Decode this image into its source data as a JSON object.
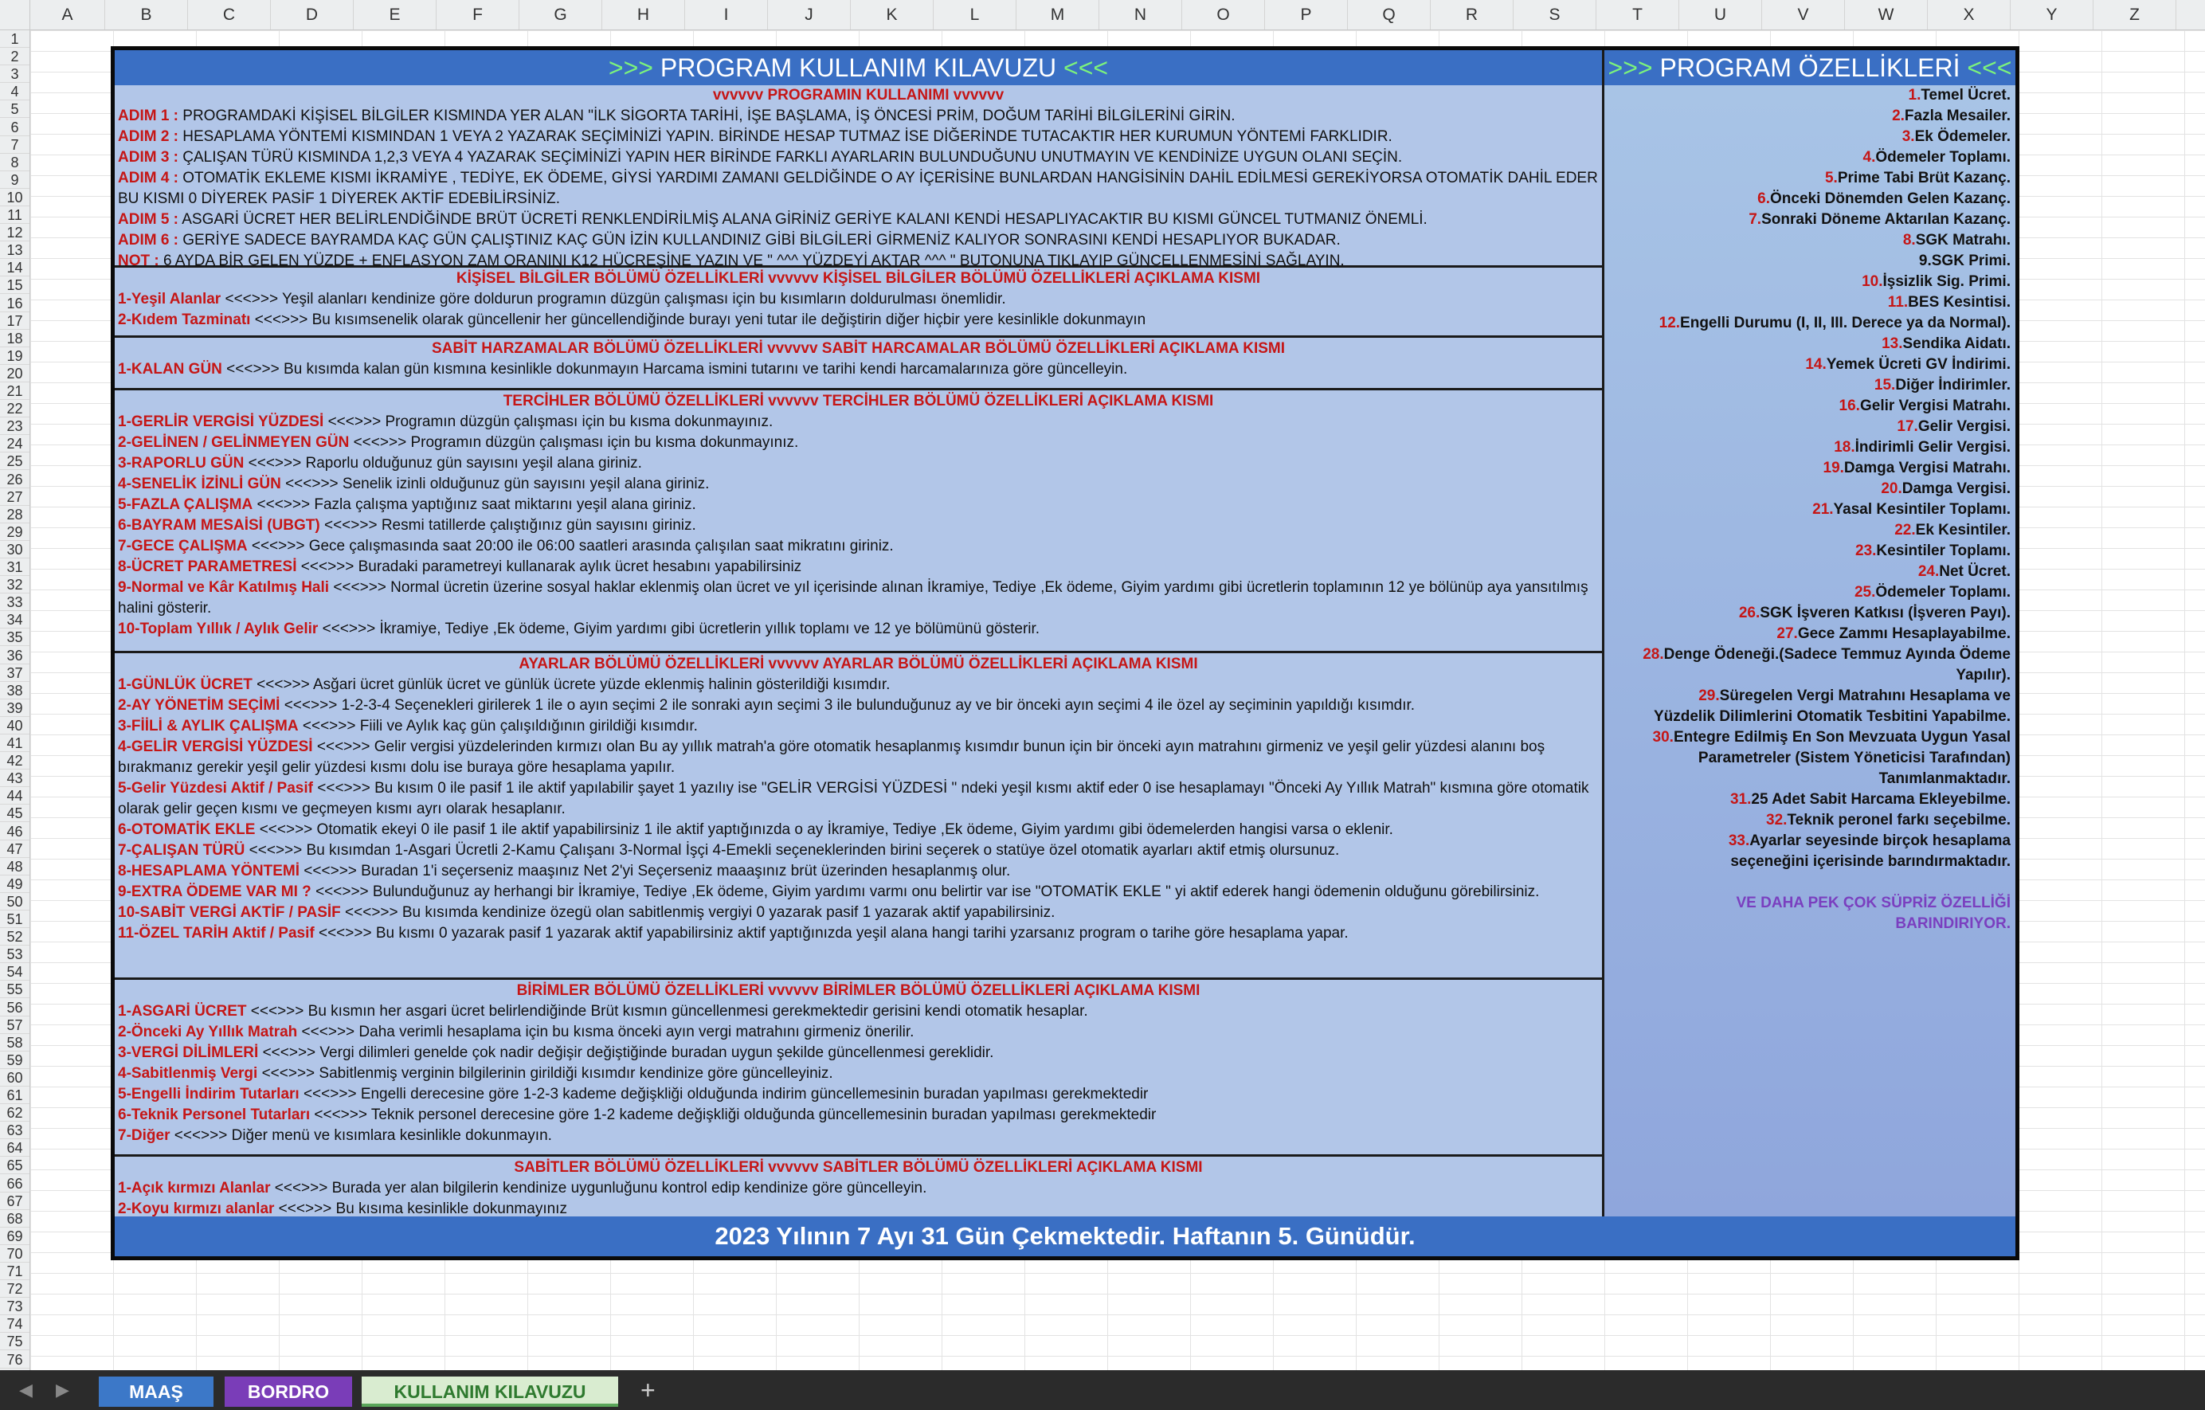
{
  "columns": [
    "A",
    "B",
    "C",
    "D",
    "E",
    "F",
    "G",
    "H",
    "I",
    "J",
    "K",
    "L",
    "M",
    "N",
    "O",
    "P",
    "Q",
    "R",
    "S",
    "T",
    "U",
    "V",
    "W",
    "X",
    "Y",
    "Z"
  ],
  "rows": [
    "1",
    "2",
    "3",
    "4",
    "5",
    "6",
    "7",
    "8",
    "9",
    "10",
    "11",
    "12",
    "13",
    "14",
    "15",
    "16",
    "17",
    "18",
    "19",
    "20",
    "21",
    "22",
    "23",
    "24",
    "25",
    "26",
    "27",
    "28",
    "29",
    "30",
    "31",
    "32",
    "33",
    "34",
    "35",
    "36",
    "37",
    "38",
    "39",
    "40",
    "41",
    "42",
    "43",
    "44",
    "45",
    "46",
    "47",
    "48",
    "49",
    "50",
    "51",
    "52",
    "53",
    "54",
    "55",
    "56",
    "57",
    "58",
    "59",
    "60",
    "61",
    "62",
    "63",
    "64",
    "65",
    "66",
    "67",
    "68",
    "69",
    "70",
    "71",
    "72",
    "73",
    "74",
    "75",
    "76"
  ],
  "title_left": {
    "arrows_l": ">>>",
    "text": " PROGRAM KULLANIM KILAVUZU ",
    "arrows_r": "<<<"
  },
  "title_right": {
    "arrows_l": ">>>",
    "text": " PROGRAM ÖZELLİKLERİ ",
    "arrows_r": "<<<"
  },
  "usage": {
    "head": "vvvvvv PROGRAMIN KULLANIMI vvvvvv",
    "lines": [
      {
        "k": "ADIM 1 :",
        "t": " PROGRAMDAKİ KİŞİSEL BİLGİLER KISMINDA YER ALAN \"İLK SİGORTA TARİHİ, İŞE BAŞLAMA, İŞ ÖNCESİ PRİM, DOĞUM TARİHİ BİLGİLERİNİ GİRİN."
      },
      {
        "k": "ADIM 2 :",
        "t": " HESAPLAMA YÖNTEMİ KISMINDAN 1 VEYA 2 YAZARAK SEÇİMİNİZİ YAPIN. BİRİNDE HESAP TUTMAZ İSE DİĞERİNDE TUTACAKTIR HER KURUMUN YÖNTEMİ FARKLIDIR."
      },
      {
        "k": "ADIM 3 :",
        "t": " ÇALIŞAN TÜRÜ KISMINDA 1,2,3 VEYA 4 YAZARAK SEÇİMİNİZİ YAPIN HER BİRİNDE FARKLI AYARLARIN BULUNDUĞUNU UNUTMAYIN VE KENDİNİZE UYGUN OLANI SEÇİN."
      },
      {
        "k": "ADIM 4 :",
        "t": " OTOMATİK EKLEME KISMI İKRAMİYE , TEDİYE, EK ÖDEME, GİYSİ YARDIMI ZAMANI  GELDİĞİNDE O AY İÇERİSİNE BUNLARDAN HANGİSİNİN DAHİL EDİLMESİ GEREKİYORSA OTOMATİK DAHİL EDER BU KISMI 0 DİYEREK PASİF 1 DİYEREK AKTİF EDEBİLİRSİNİZ."
      },
      {
        "k": "ADIM 5 :",
        "t": " ASGARİ ÜCRET HER BELİRLENDİĞİNDE BRÜT ÜCRETİ RENKLENDİRİLMİŞ ALANA GİRİNİZ GERİYE KALANI KENDİ HESAPLIYACAKTIR BU KISMI GÜNCEL TUTMANIZ ÖNEMLİ."
      },
      {
        "k": "ADIM 6 :",
        "t": " GERİYE SADECE BAYRAMDA KAÇ GÜN ÇALIŞTINIZ KAÇ GÜN İZİN KULLANDINIZ GİBİ BİLGİLERİ GİRMENİZ KALIYOR SONRASINI KENDİ HESAPLIYOR BUKADAR."
      },
      {
        "k": "NOT :",
        "t": " 6 AYDA BİR GELEN YÜZDE + ENFLASYON ZAM ORANINI K12 HÜCREŞİNE YAZIN VE \" ^^^ YÜZDEYİ AKTAR ^^^ \" BUTONUNA TIKLAYIP GÜNCELLENMESİNİ SAĞLAYIN."
      }
    ]
  },
  "personal": {
    "head": "KİŞİSEL BİLGİLER BÖLÜMÜ ÖZELLİKLERİ vvvvvv KİŞİSEL BİLGİLER  BÖLÜMÜ ÖZELLİKLERİ AÇIKLAMA KISMI",
    "lines": [
      {
        "k": "1-Yeşil Alanlar",
        "t": " <<<>>> Yeşil alanları kendinize göre doldurun programın düzgün çalışması için bu kısımların doldurulması önemlidir."
      },
      {
        "k": "2-Kıdem Tazminatı",
        "t": " <<<>>> Bu kısımsenelik olarak güncellenir her güncellendiğinde burayı yeni tutar ile değiştirin diğer hiçbir yere kesinlikle dokunmayın"
      }
    ]
  },
  "fixed": {
    "head": "SABİT HARZAMALAR BÖLÜMÜ ÖZELLİKLERİ vvvvvv SABİT HARCAMALAR BÖLÜMÜ ÖZELLİKLERİ AÇIKLAMA KISMI",
    "lines": [
      {
        "k": "1-KALAN GÜN",
        "t": " <<<>>> Bu kısımda kalan gün kısmına kesinlikle dokunmayın Harcama ismini tutarını ve tarihi kendi harcamalarınıza göre güncelleyin."
      }
    ]
  },
  "prefs": {
    "head": "TERCİHLER BÖLÜMÜ ÖZELLİKLERİ vvvvvv TERCİHLER BÖLÜMÜ ÖZELLİKLERİ AÇIKLAMA KISMI",
    "lines": [
      {
        "k": "1-GERLİR VERGİSİ YÜZDESİ",
        "t": " <<<>>> Programın düzgün çalışması için bu kısma dokunmayınız."
      },
      {
        "k": "2-GELİNEN / GELİNMEYEN GÜN",
        "t": " <<<>>> Programın düzgün çalışması için bu kısma dokunmayınız."
      },
      {
        "k": "3-RAPORLU GÜN",
        "t": " <<<>>> Raporlu olduğunuz gün sayısını yeşil alana giriniz."
      },
      {
        "k": "4-SENELİK İZİNLİ GÜN",
        "t": " <<<>>> Senelik izinli olduğunuz gün sayısını yeşil alana giriniz."
      },
      {
        "k": "5-FAZLA ÇALIŞMA",
        "t": " <<<>>> Fazla çalışma yaptığınız saat miktarını yeşil alana giriniz."
      },
      {
        "k": "6-BAYRAM MESAİSİ (UBGT)",
        "t": " <<<>>> Resmi tatillerde çalıştığınız gün sayısını giriniz."
      },
      {
        "k": "7-GECE ÇALIŞMA",
        "t": " <<<>>> Gece çalışmasında saat 20:00 ile 06:00 saatleri arasında çalışılan saat mikratını giriniz."
      },
      {
        "k": "8-ÜCRET PARAMETRESİ",
        "t": " <<<>>> Buradaki parametreyi kullanarak aylık ücret hesabını yapabilirsiniz"
      },
      {
        "k": "9-Normal ve Kâr Katılmış Hali",
        "t": " <<<>>> Normal ücretin üzerine sosyal haklar eklenmiş olan ücret ve yıl içerisinde alınan İkramiye, Tediye ,Ek ödeme, Giyim yardımı gibi ücretlerin toplamının 12 ye bölünüp aya yansıtılmış halini gösterir."
      },
      {
        "k": "10-Toplam Yıllık / Aylık Gelir",
        "t": " <<<>>> İkramiye, Tediye ,Ek ödeme, Giyim yardımı gibi ücretlerin yıllık toplamı ve 12 ye bölümünü gösterir."
      }
    ]
  },
  "settings": {
    "head": "AYARLAR BÖLÜMÜ ÖZELLİKLERİ vvvvvv AYARLAR BÖLÜMÜ ÖZELLİKLERİ AÇIKLAMA KISMI",
    "lines": [
      {
        "k": "1-GÜNLÜK ÜCRET",
        "t": " <<<>>> Asğari ücret günlük ücret ve günlük ücrete yüzde eklenmiş halinin gösterildiği kısımdır."
      },
      {
        "k": "2-AY YÖNETİM SEÇİMİ",
        "t": " <<<>>> 1-2-3-4 Seçenekleri girilerek 1 ile o ayın seçimi 2 ile sonraki ayın seçimi 3 ile bulunduğunuz ay ve bir önceki ayın seçimi 4 ile özel ay seçiminin yapıldığı kısımdır."
      },
      {
        "k": "3-FİİLİ & AYLIK ÇALIŞMA",
        "t": " <<<>>> Fiili ve Aylık kaç gün çalışıldığının girildiği kısımdır."
      },
      {
        "k": "4-GELİR VERGİSİ YÜZDESİ",
        "t": " <<<>>> Gelir vergisi yüzdelerinden kırmızı olan Bu ay yıllık matrah'a göre otomatik hesaplanmış kısımdır bunun için bir önceki ayın matrahını girmeniz ve yeşil gelir yüzdesi alanını boş bırakmanız gerekir yeşil gelir yüzdesi kısmı dolu ise buraya göre hesaplama yapılır."
      },
      {
        "k": "5-Gelir Yüzdesi Aktif / Pasif",
        "t": " <<<>>> Bu kısım 0 ile pasif 1 ile aktif yapılabilir şayet 1 yazılıy ise \"GELİR VERGİSİ YÜZDESİ \" ndeki yeşil kısmı aktif eder 0 ise hesaplamayı \"Önceki Ay Yıllık Matrah\" kısmına göre otomatik olarak gelir geçen kısmı ve geçmeyen kısmı ayrı olarak hesaplanır."
      },
      {
        "k": "6-OTOMATİK EKLE",
        "t": " <<<>>> Otomatik ekeyi 0 ile pasif 1 ile aktif yapabilirsiniz 1 ile aktif yaptığınızda o ay İkramiye, Tediye ,Ek ödeme, Giyim yardımı gibi ödemelerden hangisi varsa o eklenir."
      },
      {
        "k": "7-ÇALIŞAN TÜRÜ",
        "t": " <<<>>> Bu kısımdan 1-Asgari Ücretli 2-Kamu Çalışanı 3-Normal İşçi 4-Emekli seçeneklerinden birini seçerek o statüye özel otomatik ayarları aktif etmiş olursunuz."
      },
      {
        "k": "8-HESAPLAMA YÖNTEMİ",
        "t": " <<<>>> Buradan 1'i seçerseniz maaşınız Net 2'yi Seçerseniz maaaşınız brüt üzerinden hesaplanmış olur."
      },
      {
        "k": "9-EXTRA ÖDEME VAR MI ?",
        "t": " <<<>>> Bulunduğunuz ay herhangi bir İkramiye, Tediye ,Ek ödeme, Giyim yardımı varmı onu belirtir var ise \"OTOMATİK EKLE \" yi aktif ederek hangi ödemenin olduğunu görebilirsiniz."
      },
      {
        "k": "10-SABİT VERGİ AKTİF / PASİF",
        "t": " <<<>>> Bu kısımda kendinize özegü olan sabitlenmiş vergiyi 0 yazarak pasif 1 yazarak aktif yapabilirsiniz."
      },
      {
        "k": "11-ÖZEL TARİH Aktif / Pasif",
        "t": " <<<>>> Bu kısmı 0 yazarak pasif 1 yazarak aktif yapabilirsiniz aktif yaptığınızda yeşil alana hangi tarihi yzarsanız program o tarihe göre hesaplama yapar."
      }
    ]
  },
  "units": {
    "head": "BİRİMLER BÖLÜMÜ ÖZELLİKLERİ vvvvvv BİRİMLER BÖLÜMÜ ÖZELLİKLERİ AÇIKLAMA KISMI",
    "lines": [
      {
        "k": "1-ASGARİ ÜCRET",
        "t": " <<<>>> Bu kısmın her asgari ücret belirlendiğinde Brüt kısmın güncellenmesi gerekmektedir gerisini kendi otomatik hesaplar."
      },
      {
        "k": "2-Önceki Ay Yıllık Matrah",
        "t": " <<<>>> Daha verimli hesaplama için bu kısma önceki ayın vergi matrahını girmeniz önerilir."
      },
      {
        "k": "3-VERGİ DİLİMLERİ",
        "t": " <<<>>> Vergi dilimleri genelde çok nadir değişir değiştiğinde buradan uygun şekilde güncellenmesi gereklidir."
      },
      {
        "k": "4-Sabitlenmiş Vergi",
        "t": " <<<>>> Sabitlenmiş verginin bilgilerinin girildiği kısımdır kendinize göre güncelleyiniz."
      },
      {
        "k": "5-Engelli İndirim Tutarları",
        "t": " <<<>>> Engelli derecesine göre 1-2-3 kademe değişkliği olduğunda indirim güncellemesinin buradan yapılması gerekmektedir"
      },
      {
        "k": "6-Teknik Personel Tutarları",
        "t": " <<<>>> Teknik personel derecesine göre 1-2 kademe değişkliği olduğunda güncellemesinin buradan yapılması gerekmektedir"
      },
      {
        "k": "7-Diğer",
        "t": " <<<>>> Diğer menü ve kısımlara kesinlikle dokunmayın."
      }
    ]
  },
  "constants": {
    "head": "SABİTLER BÖLÜMÜ ÖZELLİKLERİ vvvvvv SABİTLER BÖLÜMÜ ÖZELLİKLERİ AÇIKLAMA KISMI",
    "lines": [
      {
        "k": "1-Açık kırmızı Alanlar",
        "t": " <<<>>> Burada yer alan bilgilerin kendinize uygunluğunu kontrol edip kendinize göre güncelleyin."
      },
      {
        "k": "2-Koyu kırmızı alanlar",
        "t": " <<<>>> Bu kısıma kesinlikle dokunmayınız"
      }
    ]
  },
  "features": [
    {
      "n": "1.",
      "t": "Temel Ücret."
    },
    {
      "n": "2.",
      "t": "Fazla Mesailer."
    },
    {
      "n": "3.",
      "t": "Ek Ödemeler."
    },
    {
      "n": "4.",
      "t": "Ödemeler Toplamı."
    },
    {
      "n": "5.",
      "t": "Prime Tabi Brüt Kazanç."
    },
    {
      "n": "6.",
      "t": "Önceki Dönemden Gelen Kazanç."
    },
    {
      "n": "7.",
      "t": "Sonraki Döneme Aktarılan Kazanç."
    },
    {
      "n": "8.",
      "t": "SGK Matrahı."
    },
    {
      "n": "",
      "t": "9.SGK Primi."
    },
    {
      "n": "10.",
      "t": "İşsizlik Sig. Primi."
    },
    {
      "n": "11.",
      "t": "BES Kesintisi."
    },
    {
      "n": "12.",
      "t": "Engelli Durumu (I, II, III. Derece ya da Normal)."
    },
    {
      "n": "13.",
      "t": "Sendika Aidatı."
    },
    {
      "n": "14.",
      "t": "Yemek Ücreti GV İndirimi."
    },
    {
      "n": "15.",
      "t": "Diğer İndirimler."
    },
    {
      "n": "16.",
      "t": "Gelir Vergisi Matrahı."
    },
    {
      "n": "17.",
      "t": "Gelir Vergisi."
    },
    {
      "n": "18.",
      "t": "İndirimli Gelir Vergisi."
    },
    {
      "n": "19.",
      "t": "Damga Vergisi Matrahı."
    },
    {
      "n": "20.",
      "t": "Damga Vergisi."
    },
    {
      "n": "21.",
      "t": "Yasal Kesintiler Toplamı."
    },
    {
      "n": "22.",
      "t": "Ek Kesintiler."
    },
    {
      "n": "23.",
      "t": "Kesintiler Toplamı."
    },
    {
      "n": "24.",
      "t": "Net Ücret."
    },
    {
      "n": "25.",
      "t": "Ödemeler Toplamı."
    },
    {
      "n": "26.",
      "t": "SGK İşveren Katkısı (İşveren Payı)."
    },
    {
      "n": "27.",
      "t": "Gece Zammı Hesaplayabilme."
    }
  ],
  "features_multi": [
    {
      "n": "28.",
      "t": "Denge Ödeneği.(Sadece Temmuz Ayında Ödeme",
      "t2": "Yapılır)."
    },
    {
      "n": "29.",
      "t": "Süregelen Vergi Matrahını Hesaplama ve",
      "t2": "Yüzdelik Dilimlerini Otomatik Tesbitini Yapabilme."
    },
    {
      "n": "30.",
      "t": "Entegre Edilmiş En Son Mevzuata Uygun Yasal",
      "t2": "Parametreler (Sistem Yöneticisi Tarafından)",
      "t3": "Tanımlanmaktadır."
    }
  ],
  "features_tail": [
    {
      "n": "31.",
      "t": "25 Adet Sabit Harcama Ekleyebilme."
    },
    {
      "n": "32.",
      "t": "Teknik peronel farkı seçebilme."
    },
    {
      "n": "33.",
      "t": "Ayarlar seyesinde birçok hesaplama",
      "t2": "seçeneğini içerisinde barındırmaktadır."
    }
  ],
  "surprise": {
    "l1": "VE DAHA PEK ÇOK SÜPRİZ ÖZELLİĞİ",
    "l2": "BARINDIRIYOR."
  },
  "footer": "2023 Yılının 7 Ayı 31 Gün Çekmektedir. Haftanın 5. Günüdür.",
  "tabs": {
    "prev": "◀",
    "next": "▶",
    "t1": "MAAŞ",
    "t2": "BORDRO",
    "t3": "KULLANIM KILAVUZU",
    "add": "+"
  },
  "colors": {
    "accent": "#3a6fc4",
    "red": "#c51616",
    "green": "#7cf27c",
    "purple": "#7a3fbf"
  }
}
